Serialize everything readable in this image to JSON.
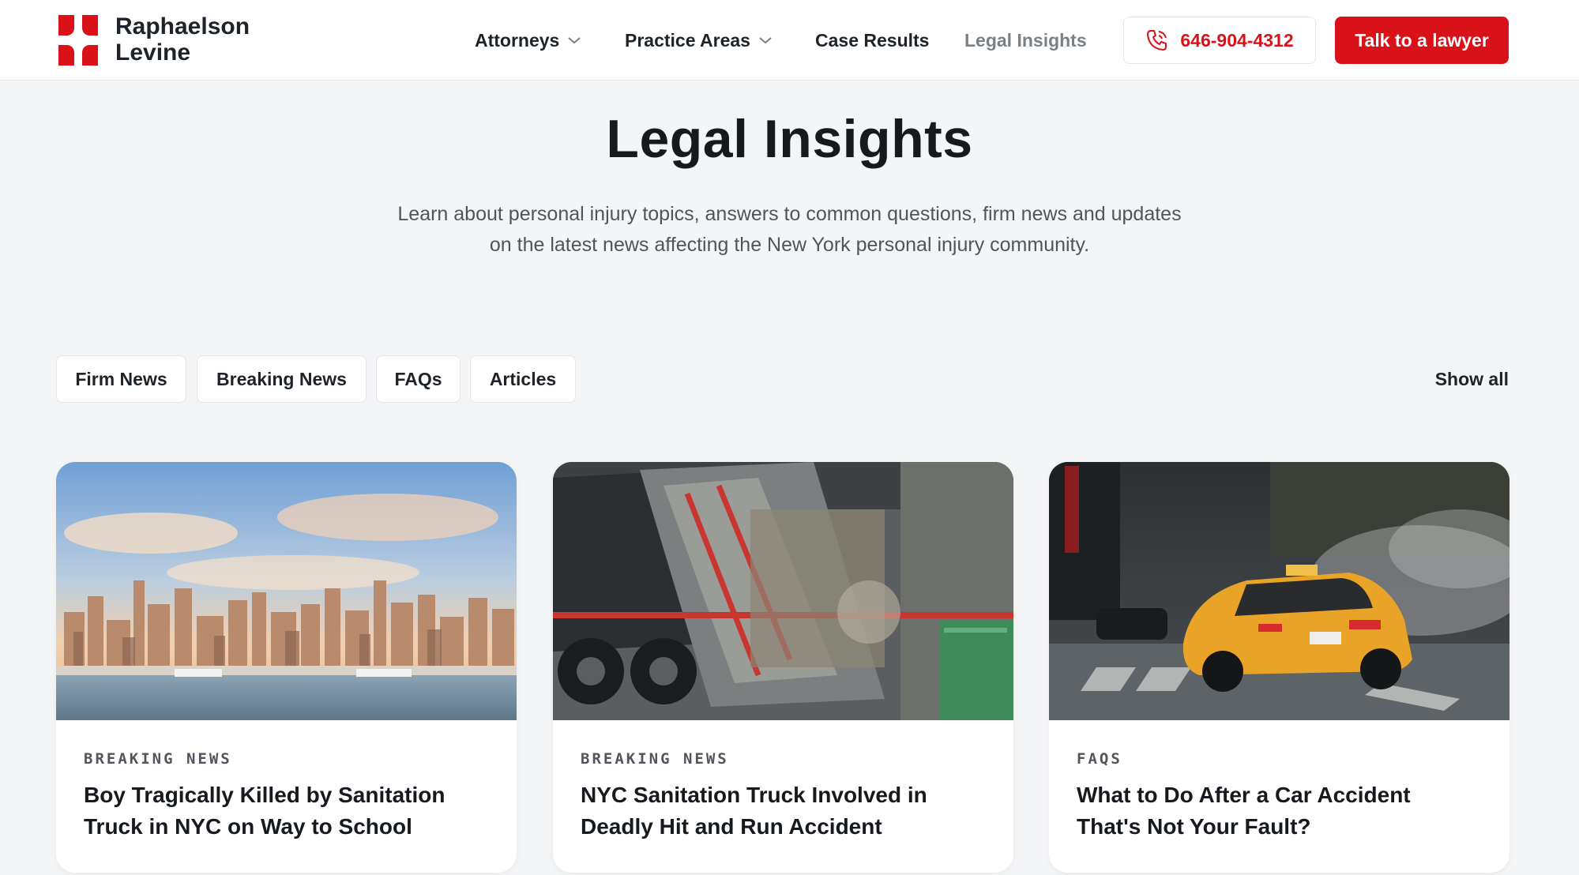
{
  "header": {
    "brand_line1": "Raphaelson",
    "brand_line2": "Levine",
    "nav": [
      {
        "label": "Attorneys",
        "dropdown": true
      },
      {
        "label": "Practice Areas",
        "dropdown": true
      },
      {
        "label": "Case Results",
        "dropdown": false
      },
      {
        "label": "Legal Insights",
        "dropdown": false,
        "active": true
      }
    ],
    "phone": "646-904-4312",
    "cta": "Talk to a lawyer"
  },
  "hero": {
    "title": "Legal Insights",
    "intro_line1": "Learn about personal injury topics, answers to common questions, firm news and updates",
    "intro_line2": "on the latest news affecting the New York personal injury community."
  },
  "filters": {
    "items": [
      "Firm News",
      "Breaking News",
      "FAQs",
      "Articles"
    ],
    "show_all": "Show all"
  },
  "cards": [
    {
      "category": "BREAKING NEWS",
      "title_line1": "Boy Tragically Killed by Sanitation",
      "title_line2": "Truck in NYC on Way to School",
      "image": "nyc-skyline-photo"
    },
    {
      "category": "BREAKING NEWS",
      "title_line1": "NYC Sanitation Truck Involved in",
      "title_line2": "Deadly Hit and Run Accident",
      "image": "garbage-truck-photo"
    },
    {
      "category": "FAQS",
      "title_line1": "What to Do After a Car Accident",
      "title_line2": "That's Not Your Fault?",
      "image": "yellow-taxi-photo"
    }
  ],
  "colors": {
    "brand_red": "#d9121a",
    "page_bg": "#f4f5f6",
    "text_dark": "#161a1f",
    "text_muted": "#7b8087"
  }
}
